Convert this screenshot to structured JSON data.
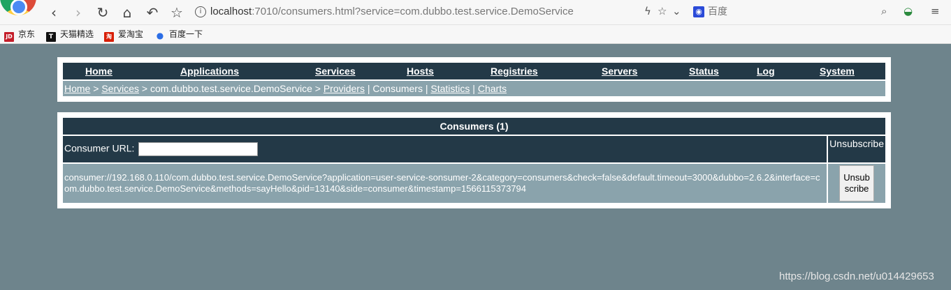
{
  "browser": {
    "url_host": "localhost",
    "url_rest": ":7010/consumers.html?service=com.dubbo.test.service.DemoService",
    "search_placeholder": "百度"
  },
  "bookmarks": [
    {
      "icon": "JD",
      "label": "京东"
    },
    {
      "icon": "T",
      "label": "天猫精选"
    },
    {
      "icon": "淘",
      "label": "爱淘宝"
    },
    {
      "icon": "paw-icon",
      "label": "百度一下"
    }
  ],
  "nav": [
    "Home",
    "Applications",
    "Services",
    "Hosts",
    "Registries",
    "Servers",
    "Status",
    "Log",
    "System"
  ],
  "breadcrumb": {
    "home": "Home",
    "services": "Services",
    "service": "com.dubbo.test.service.DemoService",
    "providers": "Providers",
    "consumers": "Consumers",
    "statistics": "Statistics",
    "charts": "Charts"
  },
  "consumers": {
    "title": "Consumers (1)",
    "filter_label": "Consumer URL:",
    "filter_value": "",
    "unsub_header": "Unsubscribe",
    "rows": [
      {
        "url": "consumer://192.168.0.110/com.dubbo.test.service.DemoService?application=user-service-sonsumer-2&category=consumers&check=false&default.timeout=3000&dubbo=2.6.2&interface=com.dubbo.test.service.DemoService&methods=sayHello&pid=13140&side=consumer&timestamp=1566115373794",
        "action": "Unsubscribe"
      }
    ]
  },
  "watermark": "https://blog.csdn.net/u014429653"
}
